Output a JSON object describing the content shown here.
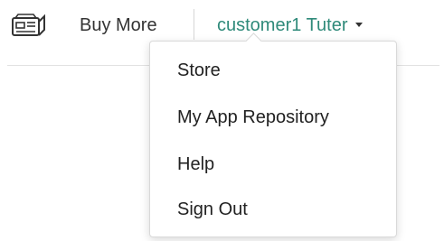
{
  "header": {
    "buy_more_label": "Buy More",
    "user_name": "customer1 Tuter",
    "icons": {
      "store": "storefront-icon",
      "caret": "caret-down-icon"
    },
    "colors": {
      "user_name": "#2f8a7a",
      "text": "#333333"
    }
  },
  "user_menu": {
    "items": [
      {
        "label": "Store"
      },
      {
        "label": "My App Repository"
      },
      {
        "label": "Help"
      },
      {
        "label": "Sign Out"
      }
    ]
  }
}
